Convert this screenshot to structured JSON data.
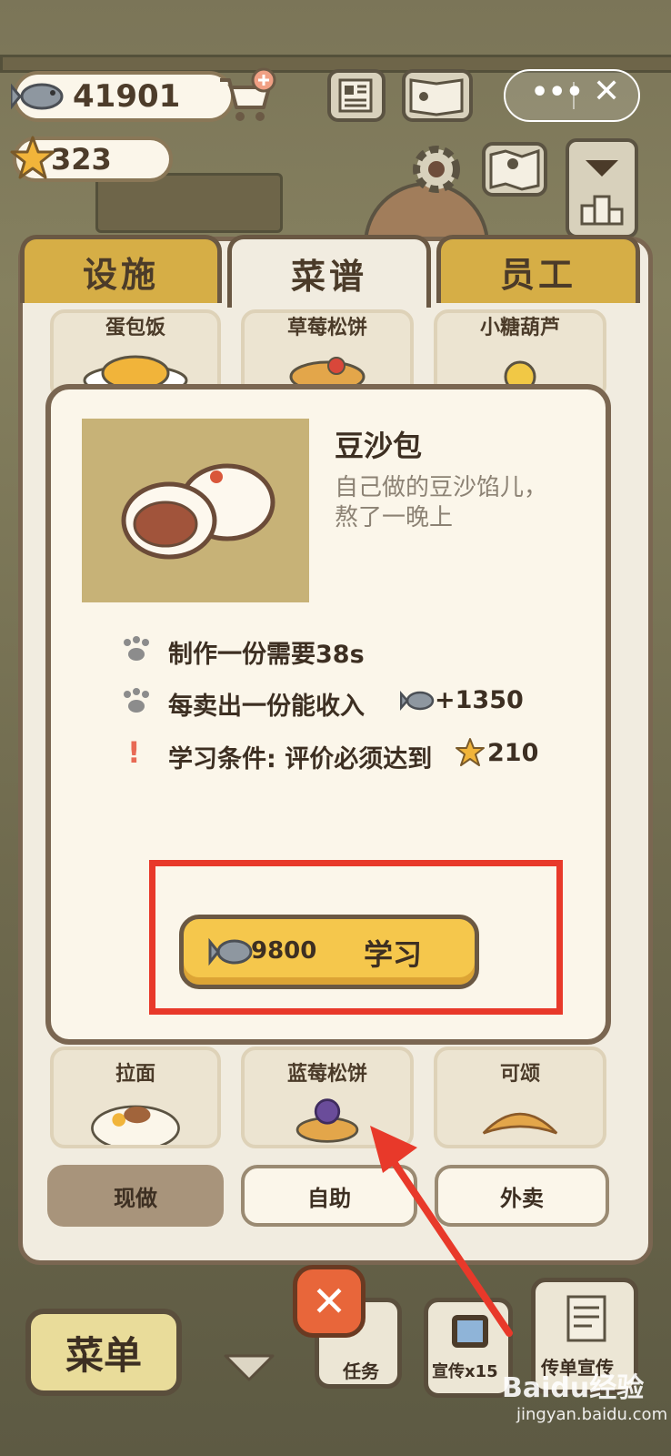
{
  "hud": {
    "fish_count": "41901",
    "star_count": "323"
  },
  "tabs": [
    {
      "label": "设施",
      "active": false
    },
    {
      "label": "菜谱",
      "active": true
    },
    {
      "label": "员工",
      "active": false
    }
  ],
  "recipes_top": [
    "蛋包饭",
    "草莓松饼",
    "小糖葫芦"
  ],
  "recipes_bottom": [
    "拉面",
    "蓝莓松饼",
    "可颂"
  ],
  "dialog": {
    "name": "豆沙包",
    "desc_line1": "自己做的豆沙馅儿，",
    "desc_line2": "熬了一晚上",
    "make_time": "制作一份需要38s",
    "income_label": "每卖出一份能收入",
    "income_value": "+1350",
    "condition_label": "学习条件: 评价必须达到",
    "condition_value": "210",
    "cost": "9800",
    "learn_label": "学习"
  },
  "filters": [
    {
      "label": "现做",
      "selected": true
    },
    {
      "label": "自助",
      "selected": false
    },
    {
      "label": "外卖",
      "selected": false
    }
  ],
  "bottom_bar": {
    "menu_label": "菜单",
    "task_label": "任务",
    "promo_label": "宣传x15",
    "flyer_label": "传单宣传"
  },
  "watermark": {
    "brand": "Baidu经验",
    "url": "jingyan.baidu.com"
  },
  "colors": {
    "accent_red": "#e8392a",
    "tab_gold": "#d6ae46",
    "button_yellow": "#f5c74c"
  }
}
